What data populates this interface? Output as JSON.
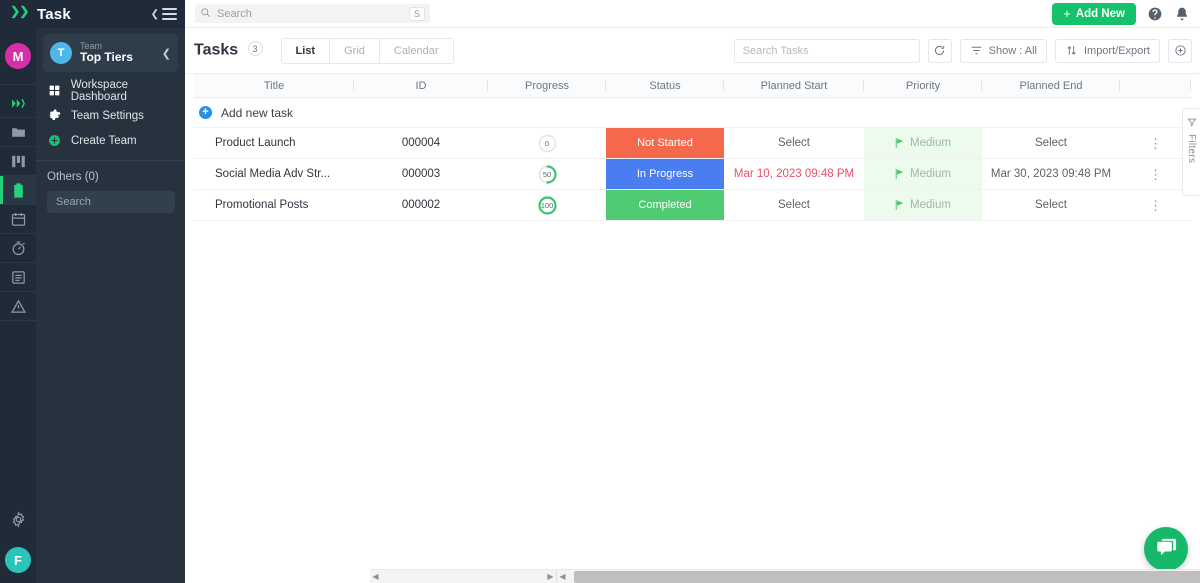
{
  "brand": {
    "name": "Task",
    "logo_icon": "infinity-logo-icon",
    "collapse_icon": "chevron-left-icon",
    "menu_icon": "hamburger-icon"
  },
  "rail": {
    "user_avatar": "M",
    "bottom_avatar": "F",
    "items": [
      {
        "icon": "infinity-logo-icon",
        "name": "workspace-logo"
      },
      {
        "icon": "folder-icon",
        "name": "folders"
      },
      {
        "icon": "columns-icon",
        "name": "boards"
      },
      {
        "icon": "clipboard-icon",
        "name": "tasks",
        "active": true
      },
      {
        "icon": "calendar-icon",
        "name": "calendar"
      },
      {
        "icon": "stopwatch-icon",
        "name": "time-tracking"
      },
      {
        "icon": "list-icon",
        "name": "documents"
      },
      {
        "icon": "warning-icon",
        "name": "issues"
      }
    ],
    "settings_icon": "gear-icon"
  },
  "sidebar": {
    "team_label": "Team",
    "team_name": "Top Tiers",
    "team_initial": "T",
    "collapse_icon": "chevron-left-icon",
    "menu": [
      {
        "label": "Workspace Dashboard",
        "icon": "grid-icon"
      },
      {
        "label": "Team Settings",
        "icon": "gear-icon"
      },
      {
        "label": "Create Team",
        "icon": "plus-circle-icon"
      }
    ],
    "others_label": "Others (0)",
    "search_placeholder": "Search"
  },
  "topbar": {
    "search_placeholder": "Search",
    "search_icon": "search-icon",
    "search_shortcut": "S",
    "add_new_label": "Add New",
    "add_new_color": "#15c26b",
    "help_icon": "question-circle-icon",
    "bell_icon": "bell-icon"
  },
  "toolbar": {
    "title": "Tasks",
    "count": "3",
    "tabs": [
      {
        "label": "List",
        "active": true
      },
      {
        "label": "Grid",
        "active": false
      },
      {
        "label": "Calendar",
        "active": false
      }
    ],
    "search_placeholder": "Search Tasks",
    "refresh_icon": "refresh-icon",
    "show_label": "Show : All",
    "show_icon": "filter-icon",
    "import_export_label": "Import/Export",
    "import_export_icon": "up-down-arrows-icon",
    "add_icon": "plus-circle-outline-icon"
  },
  "table": {
    "columns": [
      "Title",
      "ID",
      "Progress",
      "Status",
      "Planned Start",
      "Priority",
      "Planned End"
    ],
    "add_row_label": "Add new task",
    "add_row_icon": "plus-circle-icon",
    "row_menu_icon": "kebab-menu-icon",
    "empty_date_label": "Select",
    "rows": [
      {
        "title": "Product Launch",
        "id": "000004",
        "progress": 0,
        "status": "Not Started",
        "status_color": "#f4684c",
        "planned_start": "Select",
        "planned_start_overdue": false,
        "priority": "Medium",
        "planned_end": "Select"
      },
      {
        "title": "Social Media Adv Str...",
        "id": "000003",
        "progress": 50,
        "status": "In Progress",
        "status_color": "#4a7ef0",
        "planned_start": "Mar 10, 2023 09:48 PM",
        "planned_start_overdue": true,
        "priority": "Medium",
        "planned_end": "Mar 30, 2023 09:48 PM"
      },
      {
        "title": "Promotional Posts",
        "id": "000002",
        "progress": 100,
        "status": "Completed",
        "status_color": "#4fcb72",
        "planned_start": "Select",
        "planned_start_overdue": false,
        "priority": "Medium",
        "planned_end": "Select"
      }
    ]
  },
  "filters_tab": {
    "label": "Filters",
    "icon": "funnel-icon"
  },
  "chat": {
    "icon": "chat-bubble-icon",
    "color": "#17b86a"
  }
}
